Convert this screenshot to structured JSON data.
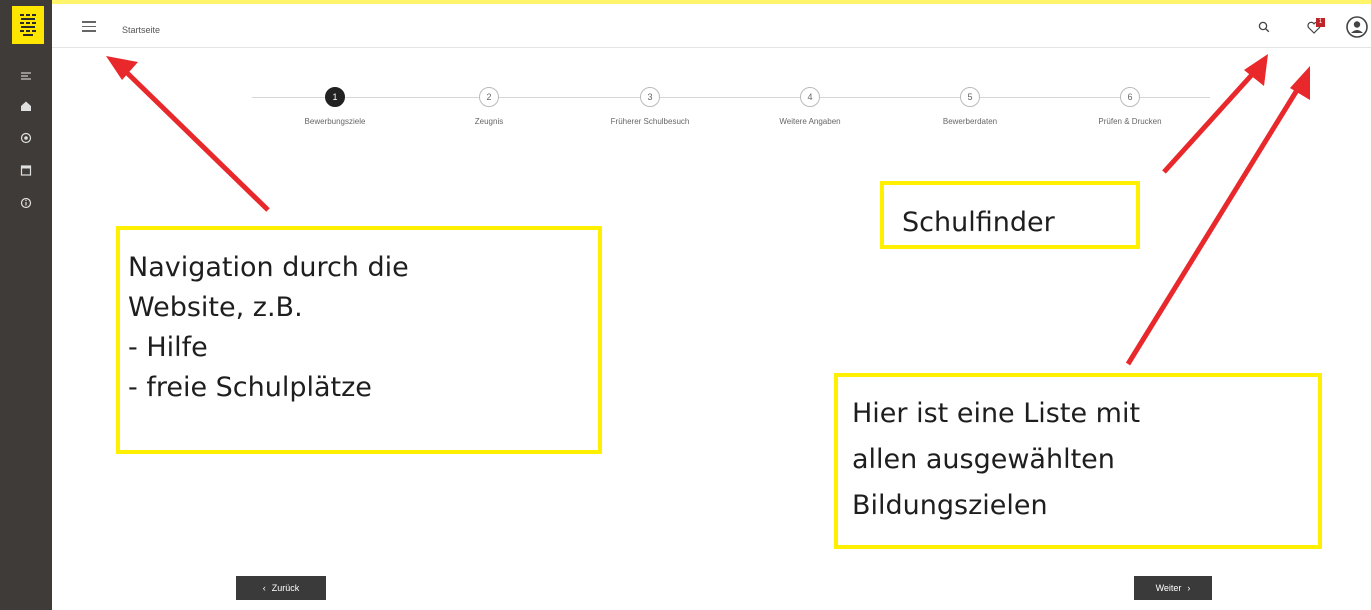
{
  "header": {
    "page_title": "Startseite",
    "badge_count": "1"
  },
  "sidebar": {
    "icons": [
      "list-icon",
      "home-icon",
      "target-icon",
      "calendar-icon",
      "info-icon"
    ]
  },
  "stepper": {
    "steps": [
      {
        "number": "1",
        "label": "Bewerbungsziele",
        "active": true
      },
      {
        "number": "2",
        "label": "Zeugnis",
        "active": false
      },
      {
        "number": "3",
        "label": "Früherer Schulbesuch",
        "active": false
      },
      {
        "number": "4",
        "label": "Weitere Angaben",
        "active": false
      },
      {
        "number": "5",
        "label": "Bewerberdaten",
        "active": false
      },
      {
        "number": "6",
        "label": "Prüfen & Drucken",
        "active": false
      }
    ]
  },
  "buttons": {
    "back_label": "Zurück",
    "next_label": "Weiter"
  },
  "annotations": {
    "navigation": {
      "line1": "Navigation durch die",
      "line2": "Website, z.B.",
      "item1": "-  Hilfe",
      "item2": "-  freie Schulplätze"
    },
    "search": "Schulfinder",
    "list": {
      "line1": "Hier ist eine Liste mit",
      "line2": "allen ausgewählten",
      "line3": "Bildungszielen"
    }
  },
  "colors": {
    "accent": "#ffe600",
    "arrow": "#e8282b",
    "sidebar": "#3f3b38",
    "badge": "#c0242b"
  }
}
